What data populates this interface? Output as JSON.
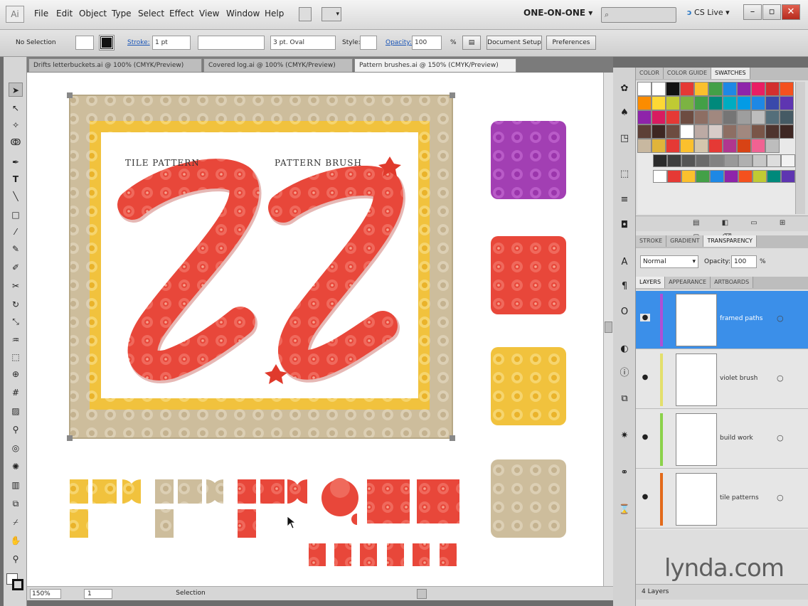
{
  "menubar": {
    "logo": "Ai",
    "items": [
      "File",
      "Edit",
      "Object",
      "Type",
      "Select",
      "Effect",
      "View",
      "Window",
      "Help"
    ],
    "workspace": "ONE-ON-ONE",
    "cslive": "CS Live",
    "search_placeholder": ""
  },
  "options_bar": {
    "selection": "No Selection",
    "stroke_label": "Stroke:",
    "stroke_value": "1 pt",
    "brush_value": "3 pt. Oval",
    "style_label": "Style:",
    "opacity_label": "Opacity:",
    "opacity_value": "100",
    "percent": "%",
    "document_setup": "Document Setup",
    "preferences": "Preferences"
  },
  "doc_tabs": [
    "Drifts letterbuckets.ai @ 100% (CMYK/Preview)",
    "Covered log.ai @ 100% (CMYK/Preview)",
    "Pattern brushes.ai @ 150% (CMYK/Preview)"
  ],
  "artboard": {
    "tile_title": "TILE PATTERN",
    "brush_title": "PATTERN BRUSH"
  },
  "status": {
    "zoom": "150%",
    "page": "1",
    "mode": "Selection"
  },
  "swatches_panel": {
    "tabs": [
      "COLOR",
      "COLOR GUIDE",
      "SWATCHES"
    ],
    "rows": [
      [
        "#ffffff",
        "#ffffff",
        "#111111",
        "#e53935",
        "#fbc02d",
        "#43a047",
        "#1e88e5",
        "#8e24aa",
        "#e91e63",
        "#d32f2f",
        "#f4511e"
      ],
      [
        "#fb8c00",
        "#fdd835",
        "#c0ca33",
        "#7cb342",
        "#43a047",
        "#00897b",
        "#00acc1",
        "#039be5",
        "#1e88e5",
        "#3949ab",
        "#5e35b1"
      ],
      [
        "#8e24aa",
        "#d81b60",
        "#e53935",
        "#6d4c41",
        "#8d6e63",
        "#a1887f",
        "#757575",
        "#9e9e9e",
        "#bdbdbd",
        "#546e7a",
        "#455a64"
      ],
      [
        "#5d4037",
        "#3e2723",
        "#6d4c41",
        "#ffffff",
        "#bcaaa4",
        "#d7ccc8",
        "#8d6e63",
        "#a1887f",
        "#795548",
        "#4e342e",
        "#3e2723"
      ]
    ],
    "grey_row": [
      "#2b2b2b",
      "#3e3e3e",
      "#555555",
      "#6b6b6b",
      "#828282",
      "#999999",
      "#b0b0b0",
      "#c7c7c7",
      "#dddddd",
      "#f2f2f2"
    ],
    "pattern_row": [
      "#ffffff",
      "#e53935",
      "#fbc02d",
      "#43a047",
      "#1e88e5",
      "#8e24aa",
      "#f4511e",
      "#c0ca33",
      "#00897b",
      "#5e35b1"
    ],
    "pattern_row2": [
      "#c8b8a0",
      "#e0b43a",
      "#e53935",
      "#fbc02d",
      "#d4c6ac",
      "#e53935",
      "#b0368f",
      "#d84315",
      "#f06292",
      "#bdbdbd"
    ]
  },
  "transparency_panel": {
    "tabs": [
      "STROKE",
      "GRADIENT",
      "TRANSPARENCY"
    ],
    "mode": "Normal",
    "opacity_label": "Opacity:",
    "opacity_value": "100",
    "percent": "%"
  },
  "layers_panel": {
    "tabs": [
      "LAYERS",
      "APPEARANCE",
      "ARTBOARDS"
    ],
    "layers": [
      {
        "name": "framed paths",
        "color": "#b04fd6",
        "selected": true
      },
      {
        "name": "violet brush",
        "color": "#e3df6b",
        "selected": false
      },
      {
        "name": "build work",
        "color": "#8bd24a",
        "selected": false
      },
      {
        "name": "tile patterns",
        "color": "#e36a1a",
        "selected": false
      }
    ],
    "count": "4 Layers"
  },
  "watermark": "lynda.com",
  "colors": {
    "red": "#e8473a",
    "gold": "#f1c23d",
    "tan": "#cdbd9c",
    "purple": "#a23fb3",
    "selection_blue": "#3b8fe9"
  }
}
